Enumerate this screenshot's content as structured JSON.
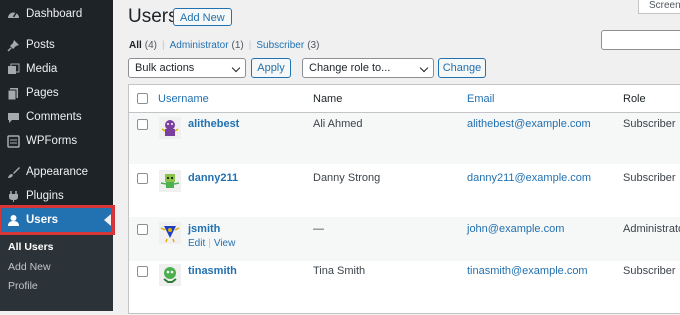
{
  "sidebar": {
    "items": [
      {
        "label": "Dashboard",
        "icon": "dashboard-icon"
      },
      {
        "label": "Posts",
        "icon": "pin-icon"
      },
      {
        "label": "Media",
        "icon": "media-icon"
      },
      {
        "label": "Pages",
        "icon": "page-icon"
      },
      {
        "label": "Comments",
        "icon": "comment-icon"
      },
      {
        "label": "WPForms",
        "icon": "forms-icon"
      },
      {
        "label": "Appearance",
        "icon": "brush-icon"
      },
      {
        "label": "Plugins",
        "icon": "plug-icon"
      },
      {
        "label": "Users",
        "icon": "user-icon"
      }
    ],
    "submenu": [
      "All Users",
      "Add New",
      "Profile"
    ]
  },
  "header": {
    "title": "Users",
    "add_new": "Add New",
    "screen_options": "Screen"
  },
  "filters": {
    "all": "All",
    "all_count": "(4)",
    "administrator": "Administrator",
    "administrator_count": "(1)",
    "subscriber": "Subscriber",
    "subscriber_count": "(3)"
  },
  "bulk": {
    "bulk_actions": "Bulk actions",
    "apply": "Apply",
    "change_role": "Change role to...",
    "change": "Change"
  },
  "table": {
    "columns": [
      "Username",
      "Name",
      "Email",
      "Role"
    ],
    "rows": [
      {
        "username": "alithebest",
        "name": "Ali Ahmed",
        "email": "alithebest@example.com",
        "role": "Subscriber"
      },
      {
        "username": "danny211",
        "name": "Danny Strong",
        "email": "danny211@example.com",
        "role": "Subscriber"
      },
      {
        "username": "jsmith",
        "name": "—",
        "email": "john@example.com",
        "role": "Administrator",
        "actions": [
          "Edit",
          "View"
        ]
      },
      {
        "username": "tinasmith",
        "name": "Tina Smith",
        "email": "tinasmith@example.com",
        "role": "Subscriber"
      }
    ]
  },
  "colors": {
    "sidebar_bg": "#1d2327",
    "accent": "#2271b1",
    "highlight_border": "#d63638"
  }
}
